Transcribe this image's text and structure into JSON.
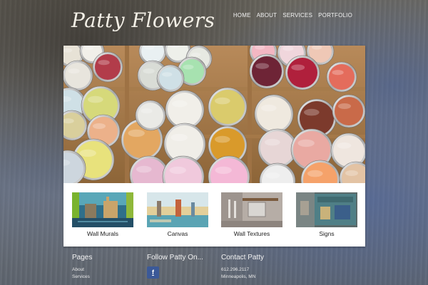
{
  "header": {
    "logo": "Patty Flowers",
    "nav": [
      {
        "label": "HOME"
      },
      {
        "label": "ABOUT"
      },
      {
        "label": "SERVICES"
      },
      {
        "label": "PORTFOLIO"
      }
    ]
  },
  "gallery": [
    {
      "caption": "Wall Murals",
      "icon": "murals-thumbnail"
    },
    {
      "caption": "Canvas",
      "icon": "canvas-thumbnail"
    },
    {
      "caption": "Wall Textures",
      "icon": "textures-thumbnail"
    },
    {
      "caption": "Signs",
      "icon": "signs-thumbnail"
    }
  ],
  "footer": {
    "pages": {
      "heading": "Pages",
      "links": [
        "About",
        "Services"
      ]
    },
    "follow": {
      "heading": "Follow Patty On...",
      "facebook_glyph": "f"
    },
    "contact": {
      "heading": "Contact Patty",
      "phone": "612.296.2117",
      "location": "Minneapolis, MN"
    }
  },
  "colors": {
    "facebook": "#3b5998",
    "card": "#ffffff"
  }
}
